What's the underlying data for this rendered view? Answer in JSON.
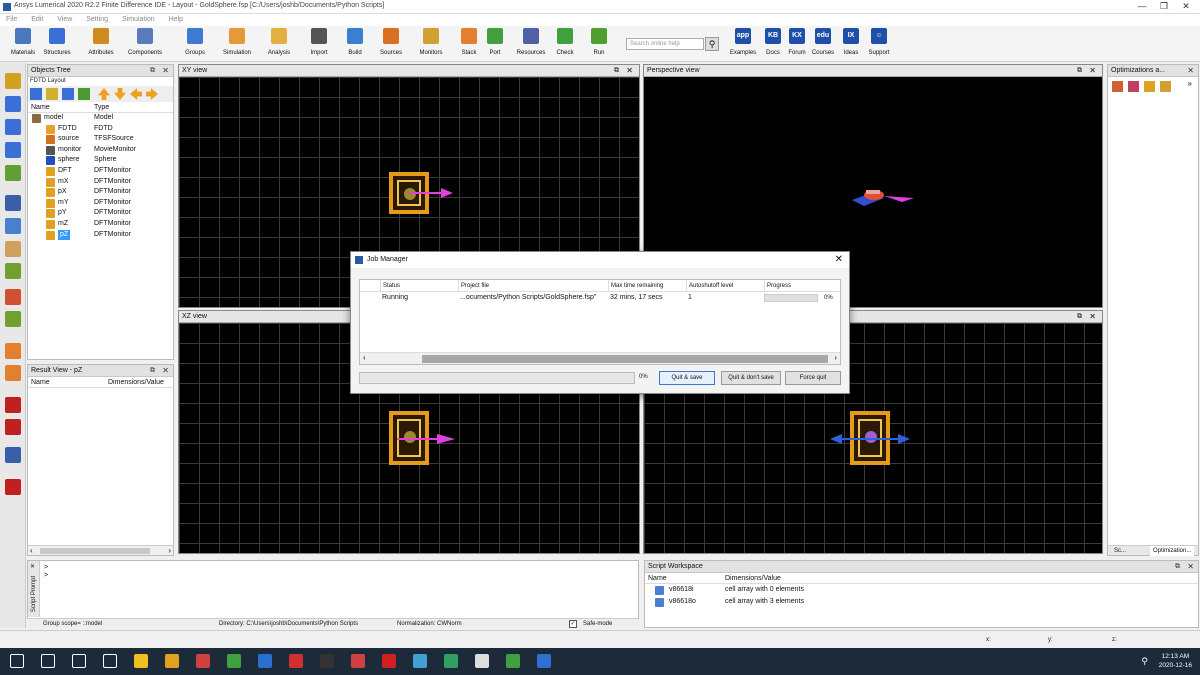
{
  "window": {
    "title": "Ansys Lumerical 2020 R2.2 Finite Difference IDE - Layout - GoldSphere.fsp [C:/Users/joshb/Documents/Python Scripts]",
    "minimize": "—",
    "maximize": "❐",
    "close": "✕"
  },
  "menu": [
    "File",
    "Edit",
    "View",
    "Setting",
    "Simulation",
    "Help"
  ],
  "toolbar": [
    {
      "label": "Materials",
      "color": "#4a78c0"
    },
    {
      "label": "Structures",
      "color": "#3a6fd8"
    },
    {
      "label": "Attributes",
      "color": "#d08a20"
    },
    {
      "label": "Components",
      "color": "#5a7ac0"
    },
    {
      "label": "Groups",
      "color": "#3f7ad0"
    },
    {
      "label": "Simulation",
      "color": "#e59a3a"
    },
    {
      "label": "Analysis",
      "color": "#e0b040"
    },
    {
      "label": "Import",
      "color": "#555555"
    },
    {
      "label": "Build",
      "color": "#3a80d0"
    },
    {
      "label": "Sources",
      "color": "#d87020"
    },
    {
      "label": "Monitors",
      "color": "#d0a030"
    },
    {
      "label": "Stack",
      "color": "#e08030"
    },
    {
      "label": "Port",
      "color": "#40a040"
    },
    {
      "label": "Resources",
      "color": "#5060a0"
    },
    {
      "label": "Check",
      "color": "#40a040"
    },
    {
      "label": "Run",
      "color": "#50a030"
    },
    {
      "label": "Examples",
      "color": "#1f4fa8"
    },
    {
      "label": "Docs",
      "color": "#1f4fa8"
    },
    {
      "label": "Forum",
      "color": "#1f4fa8"
    },
    {
      "label": "Courses",
      "color": "#1f4fa8"
    },
    {
      "label": "Ideas",
      "color": "#1f4fa8"
    },
    {
      "label": "Support",
      "color": "#1f4fa8"
    }
  ],
  "toolbar_glyphs": {
    "Examples": "app",
    "Docs": "KB",
    "Forum": "KX",
    "Courses": "edu",
    "Ideas": "IX",
    "Support": "☺"
  },
  "search": {
    "placeholder": "Search online help",
    "icon": "search-icon"
  },
  "objects_tree": {
    "title": "Objects Tree",
    "subtitle": "FDTD Layout",
    "columns": [
      "Name",
      "Type"
    ],
    "rows": [
      {
        "name": "model",
        "type": "Model",
        "color": "#8a6a40",
        "indent": 0,
        "selected": false
      },
      {
        "name": "FDTD",
        "type": "FDTD",
        "color": "#e8a030",
        "indent": 1,
        "selected": false
      },
      {
        "name": "source",
        "type": "TFSFSource",
        "color": "#d07020",
        "indent": 1,
        "selected": false
      },
      {
        "name": "monitor",
        "type": "MovieMonitor",
        "color": "#555555",
        "indent": 1,
        "selected": false
      },
      {
        "name": "sphere",
        "type": "Sphere",
        "color": "#2050c0",
        "indent": 1,
        "selected": false
      },
      {
        "name": "DFT",
        "type": "DFTMonitor",
        "color": "#e0a020",
        "indent": 1,
        "selected": false
      },
      {
        "name": "mX",
        "type": "DFTMonitor",
        "color": "#e0a020",
        "indent": 1,
        "selected": false
      },
      {
        "name": "pX",
        "type": "DFTMonitor",
        "color": "#e0a020",
        "indent": 1,
        "selected": false
      },
      {
        "name": "mY",
        "type": "DFTMonitor",
        "color": "#e0a020",
        "indent": 1,
        "selected": false
      },
      {
        "name": "pY",
        "type": "DFTMonitor",
        "color": "#e0a020",
        "indent": 1,
        "selected": false
      },
      {
        "name": "mZ",
        "type": "DFTMonitor",
        "color": "#e0a020",
        "indent": 1,
        "selected": false
      },
      {
        "name": "pZ",
        "type": "DFTMonitor",
        "color": "#e0a020",
        "indent": 1,
        "selected": true
      }
    ]
  },
  "result_view": {
    "title": "Result View - pZ",
    "columns": [
      "Name",
      "Dimensions/Value"
    ]
  },
  "views": {
    "xy": "XY view",
    "perspective": "Perspective view",
    "xz": "XZ view",
    "yz": ""
  },
  "optimizations": {
    "title": "Optimizations a...",
    "tabs": [
      "Sc...",
      "Optimization..."
    ]
  },
  "script_prompt": {
    "title": "Script Prompt",
    "lines": [
      ">",
      ">"
    ]
  },
  "status": {
    "group_scope": "Group scope= ::model",
    "directory": "Directory: C:\\Users\\joshb\\Documents\\Python Scripts",
    "normalization": "Normalization: CWNorm",
    "safe_mode": "Safe-mode",
    "x": "x:",
    "y": "y:",
    "z": "z:"
  },
  "script_workspace": {
    "title": "Script Workspace",
    "columns": [
      "Name",
      "Dimensions/Value"
    ],
    "rows": [
      {
        "name": "v86618i",
        "value": "cell array with 0 elements"
      },
      {
        "name": "v86618o",
        "value": "cell array with 3 elements"
      }
    ]
  },
  "job_manager": {
    "title": "Job Manager",
    "columns": [
      "Status",
      "Project file",
      "Max time remaining",
      "Autoshutoff level",
      "Progress"
    ],
    "row": {
      "status": "Running",
      "file": "...ocuments/Python Scripts/GoldSphere.fsp\"",
      "time": "32 mins, 17 secs",
      "autoshutoff": "1",
      "progress": 0,
      "progress_label": "0%"
    },
    "total_progress": 0,
    "total_label": "0%",
    "buttons": {
      "quit_save": "Quit & save",
      "quit_nosave": "Quit & don't save",
      "force_quit": "Force quit"
    },
    "close": "✕"
  },
  "taskbar": {
    "clock_time": "12:13 AM",
    "clock_date": "2020-12-16",
    "apps": [
      "#ffffff",
      "#ffffff",
      "#ffffff",
      "#ffffff",
      "#f0c020",
      "#e0a020",
      "#d04040",
      "#40a040",
      "#2a6fd0",
      "#d03030",
      "#333333",
      "#d04040",
      "#d02020",
      "#40a0d0",
      "#30a060",
      "#dddddd",
      "#40a040",
      "#3070d0"
    ]
  }
}
